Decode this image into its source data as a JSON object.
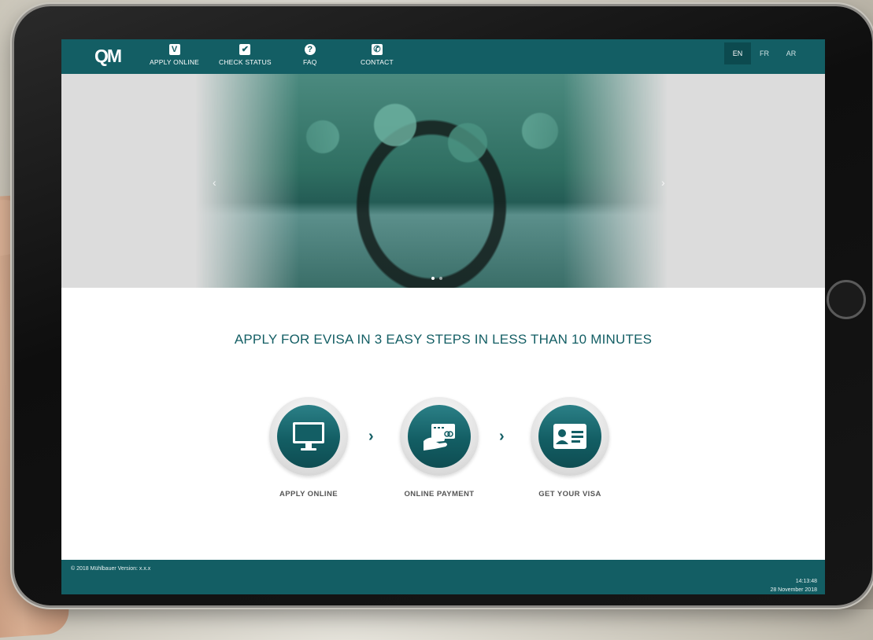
{
  "header": {
    "logo_text": "QM",
    "nav": [
      {
        "label": "APPLY ONLINE",
        "icon": "visa-v-icon"
      },
      {
        "label": "CHECK STATUS",
        "icon": "checkbox-icon"
      },
      {
        "label": "FAQ",
        "icon": "question-icon"
      },
      {
        "label": "CONTACT",
        "icon": "phone-icon"
      }
    ],
    "languages": [
      "EN",
      "FR",
      "AR"
    ],
    "active_language": "EN"
  },
  "hero": {
    "prev": "‹",
    "next": "›"
  },
  "main": {
    "headline": "APPLY FOR EVISA IN 3 EASY STEPS IN LESS THAN 10 MINUTES",
    "steps": [
      {
        "label": "APPLY ONLINE",
        "icon": "monitor-icon"
      },
      {
        "label": "ONLINE PAYMENT",
        "icon": "card-payment-icon"
      },
      {
        "label": "GET YOUR VISA",
        "icon": "id-card-icon"
      }
    ],
    "separator": "›"
  },
  "footer": {
    "copyright": "© 2018 Mühlbauer Version: x.x.x",
    "time": "14:13:48",
    "date": "28 November 2018"
  },
  "colors": {
    "brand": "#135e64",
    "background": "#ffffff"
  }
}
